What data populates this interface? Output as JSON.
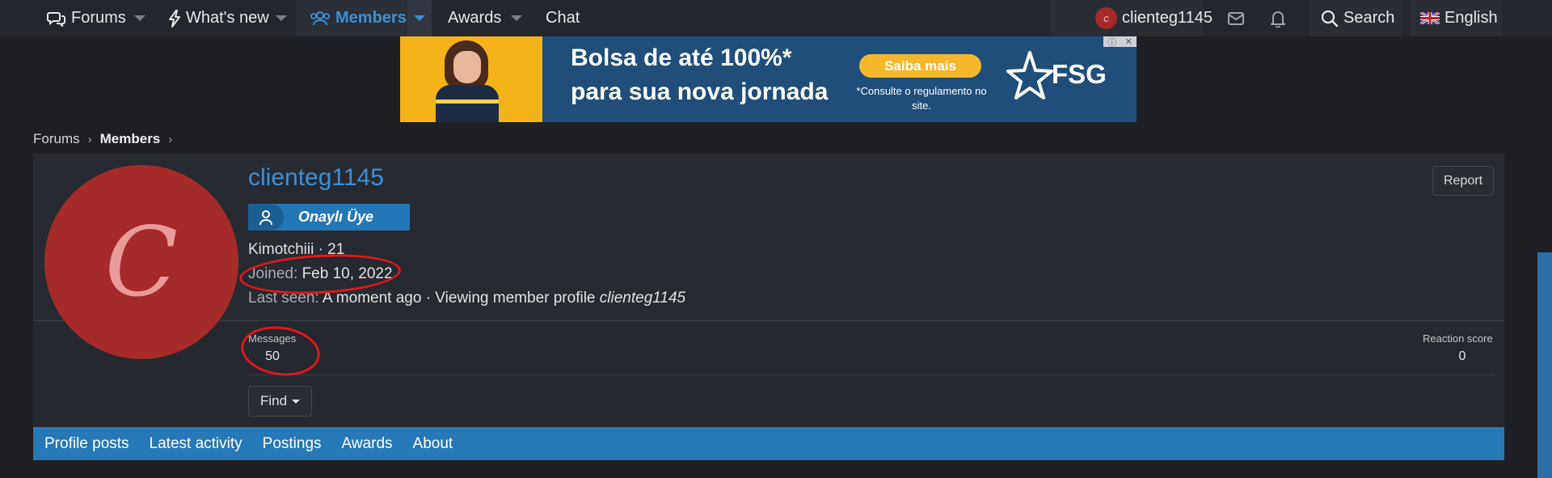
{
  "nav": {
    "forums": "Forums",
    "whats_new": "What's new",
    "members": "Members",
    "awards": "Awards",
    "chat": "Chat",
    "user_avatar_letter": "c",
    "username": "clienteg1145",
    "search": "Search",
    "language": "English"
  },
  "ad": {
    "line1": "Bolsa de até 100%*",
    "line2": "para sua nova jornada",
    "cta": "Saiba mais",
    "note": "*Consulte o regulamento no site.",
    "logo": "FSG"
  },
  "breadcrumb": {
    "forums": "Forums",
    "members": "Members"
  },
  "profile": {
    "avatar_letter": "C",
    "username": "clienteg1145",
    "banner": "Onaylı Üye",
    "title_line": "Kimotchiii · 21",
    "joined_label": "Joined:",
    "joined_value": "Feb 10, 2022",
    "last_seen_label": "Last seen:",
    "last_seen_value": "A moment ago · Viewing member profile",
    "last_seen_target": "clienteg1145",
    "report": "Report",
    "stats": {
      "messages_label": "Messages",
      "messages_value": "50",
      "reaction_label": "Reaction score",
      "reaction_value": "0"
    },
    "find": "Find"
  },
  "tabs": [
    "Profile posts",
    "Latest activity",
    "Postings",
    "Awards",
    "About"
  ],
  "colors": {
    "accent": "#2678b6",
    "link": "#3d8fd6",
    "avatar_bg": "#a52a2a",
    "annotation": "#e0171c"
  }
}
